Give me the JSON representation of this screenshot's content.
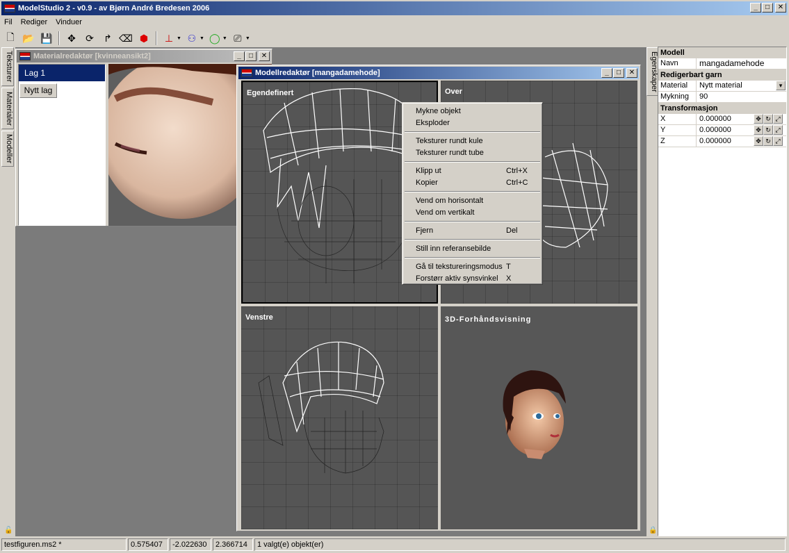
{
  "app": {
    "title": "ModelStudio 2 - v0.9 - av Bjørn André Bredesen 2006",
    "win_min": "_",
    "win_max": "□",
    "win_close": "✕"
  },
  "menubar": [
    "Fil",
    "Rediger",
    "Vinduer"
  ],
  "toolbar": {
    "icons": [
      "new-file-icon",
      "open-folder-icon",
      "save-disk-icon",
      "move-tool-icon",
      "rotate-tool-icon",
      "scale-tool-icon",
      "eraser-tool-icon",
      "paint-bucket-icon",
      "axis-icon",
      "joint-icon",
      "sphere-icon",
      "camera-icon"
    ],
    "glyphs": [
      "🗋",
      "📂",
      "💾",
      "✥",
      "⟳",
      "↱",
      "⌫",
      "⬢",
      "⊥",
      "⚇",
      "◯",
      "⎚"
    ]
  },
  "left_tabs": [
    "Teksturer",
    "Materialer",
    "Modeller"
  ],
  "material_editor": {
    "title": "Materialredaktør [kvinneansikt2]",
    "layers": [
      "Lag 1"
    ],
    "new_layer_button": "Nytt lag"
  },
  "model_editor": {
    "title": "Modellredaktør [mangadamehode]",
    "viewports": [
      "Egendefinert",
      "Over",
      "Venstre",
      "3D-Forhåndsvisning"
    ]
  },
  "context_menu": {
    "groups": [
      [
        {
          "label": "Mykne objekt",
          "shortcut": ""
        },
        {
          "label": "Eksploder",
          "shortcut": ""
        }
      ],
      [
        {
          "label": "Teksturer rundt kule",
          "shortcut": ""
        },
        {
          "label": "Teksturer rundt tube",
          "shortcut": ""
        }
      ],
      [
        {
          "label": "Klipp ut",
          "shortcut": "Ctrl+X"
        },
        {
          "label": "Kopier",
          "shortcut": "Ctrl+C"
        }
      ],
      [
        {
          "label": "Vend om horisontalt",
          "shortcut": ""
        },
        {
          "label": "Vend om vertikalt",
          "shortcut": ""
        }
      ],
      [
        {
          "label": "Fjern",
          "shortcut": "Del"
        }
      ],
      [
        {
          "label": "Still inn referansebilde",
          "shortcut": ""
        }
      ],
      [
        {
          "label": "Gå til tekstureringsmodus",
          "shortcut": "T"
        },
        {
          "label": "Forstørr aktiv synsvinkel",
          "shortcut": "X"
        }
      ]
    ]
  },
  "right_tab": "Egenskaper",
  "properties": {
    "model_header": "Modell",
    "name_key": "Navn",
    "name_value": "mangadamehode",
    "mesh_header": "Redigerbart garn",
    "material_key": "Material",
    "material_value": "Nytt material",
    "smoothing_key": "Mykning",
    "smoothing_value": "90",
    "transform_header": "Transformasjon",
    "transform": [
      {
        "key": "X",
        "value": "0.000000"
      },
      {
        "key": "Y",
        "value": "0.000000"
      },
      {
        "key": "Z",
        "value": "0.000000"
      }
    ]
  },
  "statusbar": {
    "file": "testfiguren.ms2 *",
    "x": "0.575407",
    "y": "-2.022630",
    "z": "2.366714",
    "selection": "1 valgt(e) objekt(er)"
  }
}
